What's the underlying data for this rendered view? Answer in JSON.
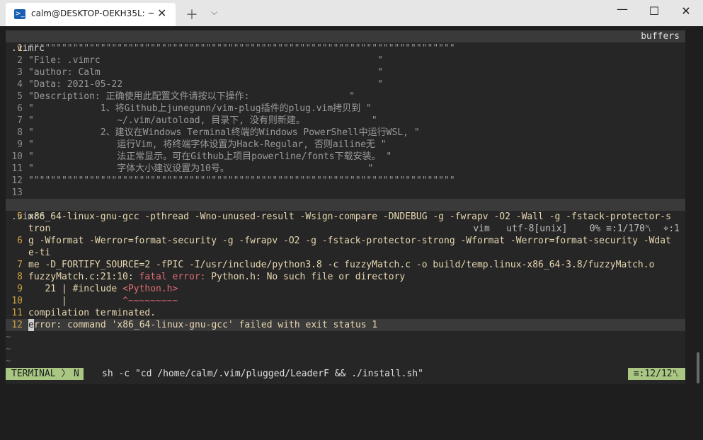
{
  "window": {
    "tab_title": "calm@DESKTOP-OEKH35L: ~",
    "tab_icon_glyph": ">_",
    "tab_close": "✕",
    "new_tab": "＋",
    "dropdown": "⌵",
    "minimize": "—",
    "maximize": "☐",
    "close": "✕"
  },
  "top_bar": {
    "filename": ".vimrc",
    "buffers": "buffers"
  },
  "editor_lines": [
    {
      "n": "1",
      "text": "\"\"\"\"\"\"\"\"\"\"\"\"\"\"\"\"\"\"\"\"\"\"\"\"\"\"\"\"\"\"\"\"\"\"\"\"\"\"\"\"\"\"\"\"\"\"\"\"\"\"\"\"\"\"\"\"\"\"\"\"\"\"\"\"\"\"\"\"\"\"\"\"\"\"\"\"\""
    },
    {
      "n": "2",
      "text": "\"File: .vimrc                                                  \""
    },
    {
      "n": "3",
      "text": "\"author: Calm                                                  \""
    },
    {
      "n": "4",
      "text": "\"Data: 2021-05-22                                              \""
    },
    {
      "n": "5",
      "text": "\"Description: 正确使用此配置文件请按以下操作:                  \""
    },
    {
      "n": "6",
      "text": "\"            1、将Github上junegunn/vim-plug插件的plug.vim拷贝到 \""
    },
    {
      "n": "7",
      "text": "\"               ~/.vim/autoload, 目录下, 没有则新建。            \""
    },
    {
      "n": "8",
      "text": "\"            2、建议在Windows Terminal终端的Windows PowerShell中运行WSL, \""
    },
    {
      "n": "9",
      "text": "\"               运行Vim, 将终端字体设置为Hack-Regular, 否则ailine无 \""
    },
    {
      "n": "10",
      "text": "\"               法正常显示。可在Github上项目powerline/fonts下载安装。 \""
    },
    {
      "n": "11",
      "text": "\"               字体大小建议设置为10号。                         \""
    },
    {
      "n": "12",
      "text": "\"\"\"\"\"\"\"\"\"\"\"\"\"\"\"\"\"\"\"\"\"\"\"\"\"\"\"\"\"\"\"\"\"\"\"\"\"\"\"\"\"\"\"\"\"\"\"\"\"\"\"\"\"\"\"\"\"\"\"\"\"\"\"\"\"\"\"\"\"\"\"\"\"\"\"\"\""
    },
    {
      "n": "13",
      "text": ""
    }
  ],
  "status_line": {
    "filename": ".vimrc",
    "right": "vim   utf-8[unix]    0% ≡:1/170␤  ⌖:1"
  },
  "terminal_lines": {
    "l5a": "x86_64-linux-gnu-gcc -pthread -Wno-unused-result -Wsign-compare -DNDEBUG -g -fwrapv -O2 -Wall -g -fstack-protector-s",
    "l5b": "tron",
    "l6a": "g -Wformat -Werror=format-security -g -fwrapv -O2 -g -fstack-protector-strong -Wformat -Werror=format-security -Wdat",
    "l6b": "e-ti",
    "l7": "me -D_FORTIFY_SOURCE=2 -fPIC -I/usr/include/python3.8 -c fuzzyMatch.c -o build/temp.linux-x86_64-3.8/fuzzyMatch.o",
    "l8_pre": "fuzzyMatch.c:21:10: ",
    "l8_err": "fatal error: ",
    "l8_post": "Python.h: No such file or directory",
    "l9_pre": "   21 | #include ",
    "l9_red": "<Python.h>",
    "l10_pre": "      |          ",
    "l10_red": "^~~~~~~~~~",
    "l11": "compilation terminated.",
    "l12_cursor": "e",
    "l12_rest": "rror: command 'x86_64-linux-gnu-gcc' failed with exit status 1",
    "n5": "5",
    "n6": "6",
    "n7": "7",
    "n8": "8",
    "n9": "9",
    "n10": "10",
    "n11": "11",
    "n12": "12"
  },
  "tildes": [
    "~",
    "~",
    "~"
  ],
  "bottom_bar": {
    "mode": "TERMINAL",
    "sep": "〉",
    "sub_mode": "N",
    "command": "sh -c \"cd /home/calm/.vim/plugged/LeaderF && ./install.sh\"",
    "position": "≡:12/12␤"
  },
  "colors": {
    "mode_bg": "#a9c783",
    "error_red": "#e06c75",
    "line_nr_current": "#e5c07b"
  }
}
